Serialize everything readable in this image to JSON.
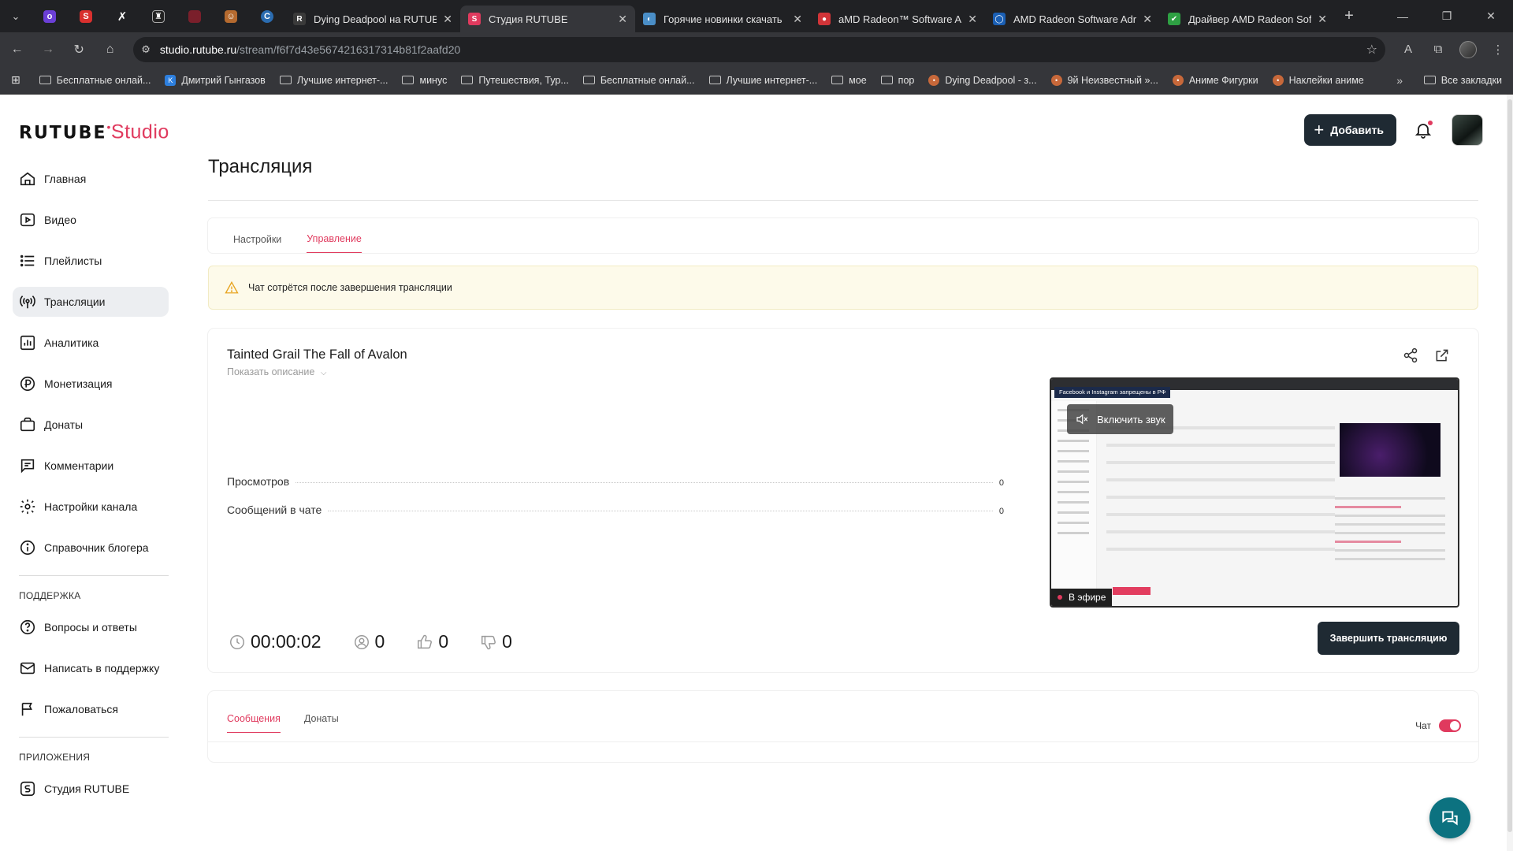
{
  "browser": {
    "tabs": [
      {
        "title": "Dying Deadpool на RUTUBE",
        "fav_color": "#3a3a3a",
        "fav_text": "R",
        "active": false
      },
      {
        "title": "Студия RUTUBE",
        "fav_color": "#e03a5e",
        "fav_text": "S",
        "active": true
      },
      {
        "title": "Горячие новинки скачать",
        "fav_color": "#4a8ec7",
        "fav_text": "◐",
        "active": false
      },
      {
        "title": "aMD Radeon™ Software Adr",
        "fav_color": "#d13438",
        "fav_text": "●",
        "active": false
      },
      {
        "title": "AMD Radeon Software Adre",
        "fav_color": "#1a5fb4",
        "fav_text": "◯",
        "active": false
      },
      {
        "title": "Драйвер AMD Radeon Softw",
        "fav_color": "#2ea043",
        "fav_text": "✔",
        "active": false
      }
    ],
    "url_host": "studio.rutube.ru",
    "url_path": "/stream/f6f7d43e5674216317314b81f2aafd20",
    "bookmarks": [
      {
        "label": "Бесплатные онлай...",
        "icon": "folder-icon"
      },
      {
        "label": "Дмитрий Гынгазов",
        "icon": "vk-icon"
      },
      {
        "label": "Лучшие интернет-...",
        "icon": "folder-icon"
      },
      {
        "label": "минус",
        "icon": "folder-icon"
      },
      {
        "label": "Путешествия, Тур...",
        "icon": "folder-icon"
      },
      {
        "label": "Бесплатные онлай...",
        "icon": "folder-icon"
      },
      {
        "label": "Лучшие интернет-...",
        "icon": "folder-icon"
      },
      {
        "label": "мое",
        "icon": "folder-icon"
      },
      {
        "label": "пор",
        "icon": "folder-icon"
      },
      {
        "label": "Dying Deadpool - з...",
        "icon": "site-icon"
      },
      {
        "label": "9й Неизвестный »...",
        "icon": "site-icon"
      },
      {
        "label": "Аниме Фигурки",
        "icon": "site-icon"
      },
      {
        "label": "Наклейки аниме",
        "icon": "site-icon"
      }
    ],
    "all_bookmarks": "Все закладки",
    "more": "»"
  },
  "header": {
    "logo_main": "RUTUBE",
    "logo_accent": "Studio",
    "add_label": "Добавить"
  },
  "sidebar": {
    "items": [
      {
        "label": "Главная",
        "icon": "home-icon"
      },
      {
        "label": "Видео",
        "icon": "video-icon"
      },
      {
        "label": "Плейлисты",
        "icon": "playlist-icon"
      },
      {
        "label": "Трансляции",
        "icon": "broadcast-icon"
      },
      {
        "label": "Аналитика",
        "icon": "analytics-icon"
      },
      {
        "label": "Монетизация",
        "icon": "monetization-icon"
      },
      {
        "label": "Донаты",
        "icon": "donate-icon"
      },
      {
        "label": "Комментарии",
        "icon": "comments-icon"
      },
      {
        "label": "Настройки канала",
        "icon": "settings-icon"
      },
      {
        "label": "Справочник блогера",
        "icon": "info-icon"
      }
    ],
    "support_title": "ПОДДЕРЖКА",
    "support_items": [
      {
        "label": "Вопросы и ответы",
        "icon": "question-icon"
      },
      {
        "label": "Написать в поддержку",
        "icon": "mail-icon"
      },
      {
        "label": "Пожаловаться",
        "icon": "flag-icon"
      }
    ],
    "apps_title": "ПРИЛОЖЕНИЯ",
    "apps_items": [
      {
        "label": "Студия RUTUBE",
        "icon": "studio-icon"
      }
    ]
  },
  "main": {
    "title": "Трансляция",
    "tabs": [
      "Настройки",
      "Управление"
    ],
    "warning": "Чат сотрётся после завершения трансляции",
    "stream": {
      "title": "Tainted Grail The Fall of Avalon",
      "show_description": "Показать описание",
      "stats": [
        {
          "label": "Просмотров",
          "value": "0"
        },
        {
          "label": "Сообщений в чате",
          "value": "0"
        }
      ],
      "duration": "00:00:02",
      "viewers": "0",
      "likes": "0",
      "dislikes": "0",
      "preview": {
        "sound_label": "Включить звук",
        "live_label": "В эфире",
        "banner": "Facebook и Instagram запрещены в РФ"
      },
      "end_label": "Завершить трансляцию"
    },
    "chat": {
      "tabs": [
        "Сообщения",
        "Донаты"
      ],
      "toggle_label": "Чат",
      "toggle_on": true
    }
  }
}
